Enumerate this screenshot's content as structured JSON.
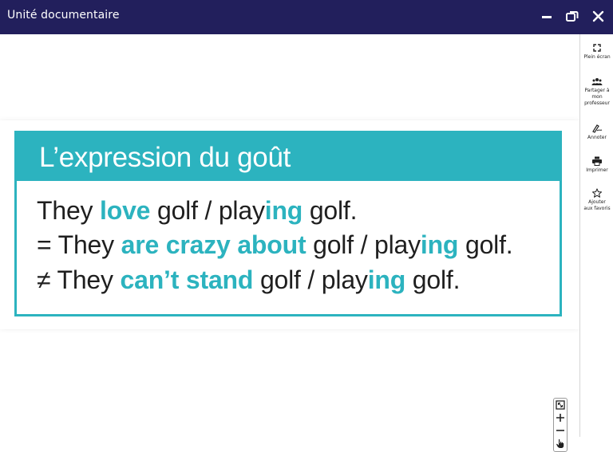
{
  "window": {
    "title": "Unité documentaire",
    "minimize_icon": "minimize-icon",
    "restore_icon": "restore-icon",
    "close_icon": "close-icon"
  },
  "slide": {
    "heading": "L’expression du goût",
    "lines": [
      {
        "prefix": "They ",
        "hl1": "love",
        "mid": " golf / play",
        "hl2": "ing",
        "suffix": " golf."
      },
      {
        "prefix": "= They ",
        "hl1": "are crazy about",
        "mid": " golf / play",
        "hl2": "ing",
        "suffix": " golf."
      },
      {
        "prefix": "≠ They ",
        "hl1": "can’t stand",
        "mid": " golf / play",
        "hl2": "ing",
        "suffix": " golf."
      }
    ],
    "colors": {
      "accent": "#2cb3bf",
      "titlebar": "#221f5c",
      "text": "#1f1f1f"
    }
  },
  "sidebar": {
    "fullscreen": "Plein écran",
    "share_1": "Partager à",
    "share_2": "mon",
    "share_3": "professeur",
    "annotate": "Annoter",
    "print": "Imprimer",
    "favorite_1": "Ajouter",
    "favorite_2": "aux favoris"
  },
  "zoom_controls": [
    "fit-icon",
    "zoom-in-icon",
    "zoom-out-icon",
    "pan-hand-icon"
  ]
}
